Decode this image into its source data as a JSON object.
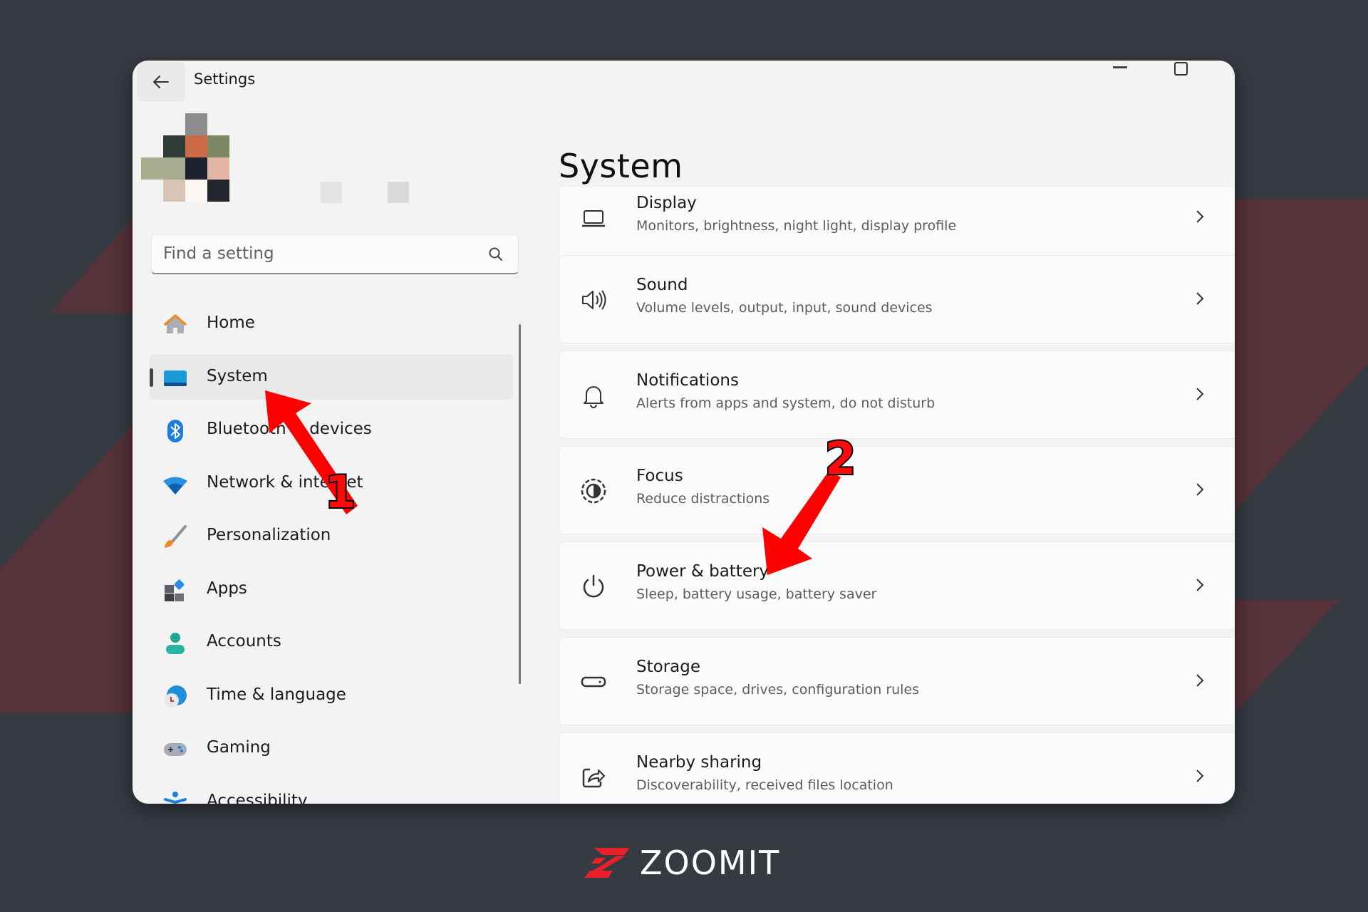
{
  "window": {
    "title": "Settings",
    "controls": {
      "minimize": "minimize-icon",
      "maximize": "maximize-icon"
    }
  },
  "search": {
    "placeholder": "Find a setting",
    "value": ""
  },
  "sidebar": {
    "items": [
      {
        "label": "Home",
        "icon": "home-icon",
        "selected": false
      },
      {
        "label": "System",
        "icon": "system-icon",
        "selected": true
      },
      {
        "label": "Bluetooth & devices",
        "icon": "bluetooth-icon",
        "selected": false
      },
      {
        "label": "Network & internet",
        "icon": "wifi-icon",
        "selected": false
      },
      {
        "label": "Personalization",
        "icon": "brush-icon",
        "selected": false
      },
      {
        "label": "Apps",
        "icon": "apps-icon",
        "selected": false
      },
      {
        "label": "Accounts",
        "icon": "account-icon",
        "selected": false
      },
      {
        "label": "Time & language",
        "icon": "globe-clock-icon",
        "selected": false
      },
      {
        "label": "Gaming",
        "icon": "gamepad-icon",
        "selected": false
      },
      {
        "label": "Accessibility",
        "icon": "accessibility-icon",
        "selected": false
      }
    ]
  },
  "main": {
    "title": "System",
    "cards": [
      {
        "title": "Display",
        "desc": "Monitors, brightness, night light, display profile",
        "icon": "display-icon"
      },
      {
        "title": "Sound",
        "desc": "Volume levels, output, input, sound devices",
        "icon": "speaker-icon"
      },
      {
        "title": "Notifications",
        "desc": "Alerts from apps and system, do not disturb",
        "icon": "bell-icon"
      },
      {
        "title": "Focus",
        "desc": "Reduce distractions",
        "icon": "focus-icon"
      },
      {
        "title": "Power & battery",
        "desc": "Sleep, battery usage, battery saver",
        "icon": "power-icon"
      },
      {
        "title": "Storage",
        "desc": "Storage space, drives, configuration rules",
        "icon": "storage-icon"
      },
      {
        "title": "Nearby sharing",
        "desc": "Discoverability, received files location",
        "icon": "share-icon"
      }
    ]
  },
  "annotations": {
    "step1": "1",
    "step2": "2",
    "color": "#ff0000"
  },
  "branding": {
    "logo_text": "ZOOMIT",
    "accent": "#e8202c"
  },
  "colors": {
    "background": "#363b42",
    "background_shape": "#56323a",
    "window": "#f3f3f3",
    "card": "#fbfbfb"
  }
}
